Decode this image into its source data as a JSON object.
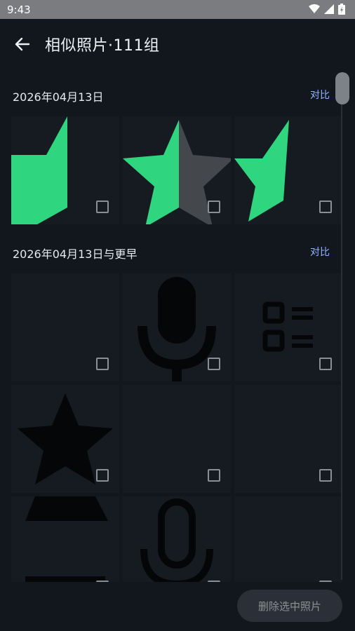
{
  "status_bar": {
    "time": "9:43"
  },
  "header": {
    "title": "相似照片·111组"
  },
  "groups": [
    {
      "title": "2026年04月13日",
      "compare_label": "对比"
    },
    {
      "title": "2026年04月13日与更早",
      "compare_label": "对比"
    }
  ],
  "footer": {
    "delete_label": "删除选中照片"
  },
  "colors": {
    "accent_green": "#2fd67f",
    "link_blue": "#8fb6ff",
    "background": "#12161d"
  }
}
